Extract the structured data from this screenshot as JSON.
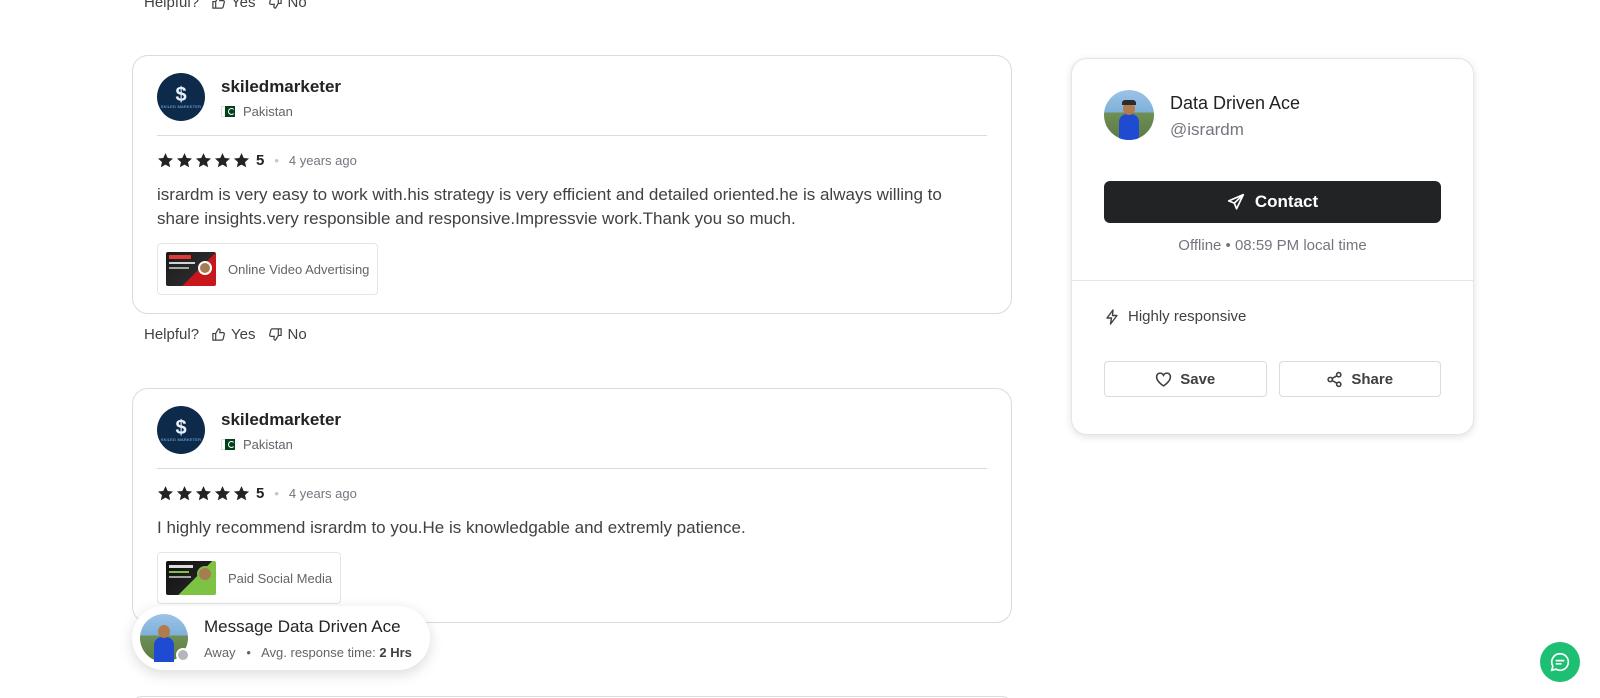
{
  "helpful": {
    "label": "Helpful?",
    "yes": "Yes",
    "no": "No"
  },
  "reviews": [
    {
      "username": "skiledmarketer",
      "country": "Pakistan",
      "rating": "5",
      "time": "4 years ago",
      "text": "isrardm is very easy to work with.his strategy is very efficient and detailed oriented.he is always willing to share insights.very responsible and responsive.Impressvie work.Thank you so much.",
      "gig": "Online Video Advertising"
    },
    {
      "username": "skiledmarketer",
      "country": "Pakistan",
      "rating": "5",
      "time": "4 years ago",
      "text": "I highly recommend isrardm to you.He is knowledgable and extremly patience.",
      "gig": "Paid Social Media"
    }
  ],
  "seller": {
    "name": "Data Driven Ace",
    "handle": "@isrardm",
    "contact_label": "Contact",
    "status": "Offline • 08:59 PM local time",
    "badge": "Highly responsive",
    "save_label": "Save",
    "share_label": "Share"
  },
  "message_bubble": {
    "title": "Message Data Driven Ace",
    "status": "Away",
    "response_label": "Avg. response time:",
    "response_value": "2 Hrs"
  },
  "colors": {
    "brand_green": "#1dbf73",
    "dark_button": "#222325"
  },
  "icons": [
    "thumbs-up-icon",
    "thumbs-down-icon",
    "star-icon",
    "send-icon",
    "lightning-icon",
    "heart-icon",
    "share-icon",
    "chat-icon"
  ]
}
